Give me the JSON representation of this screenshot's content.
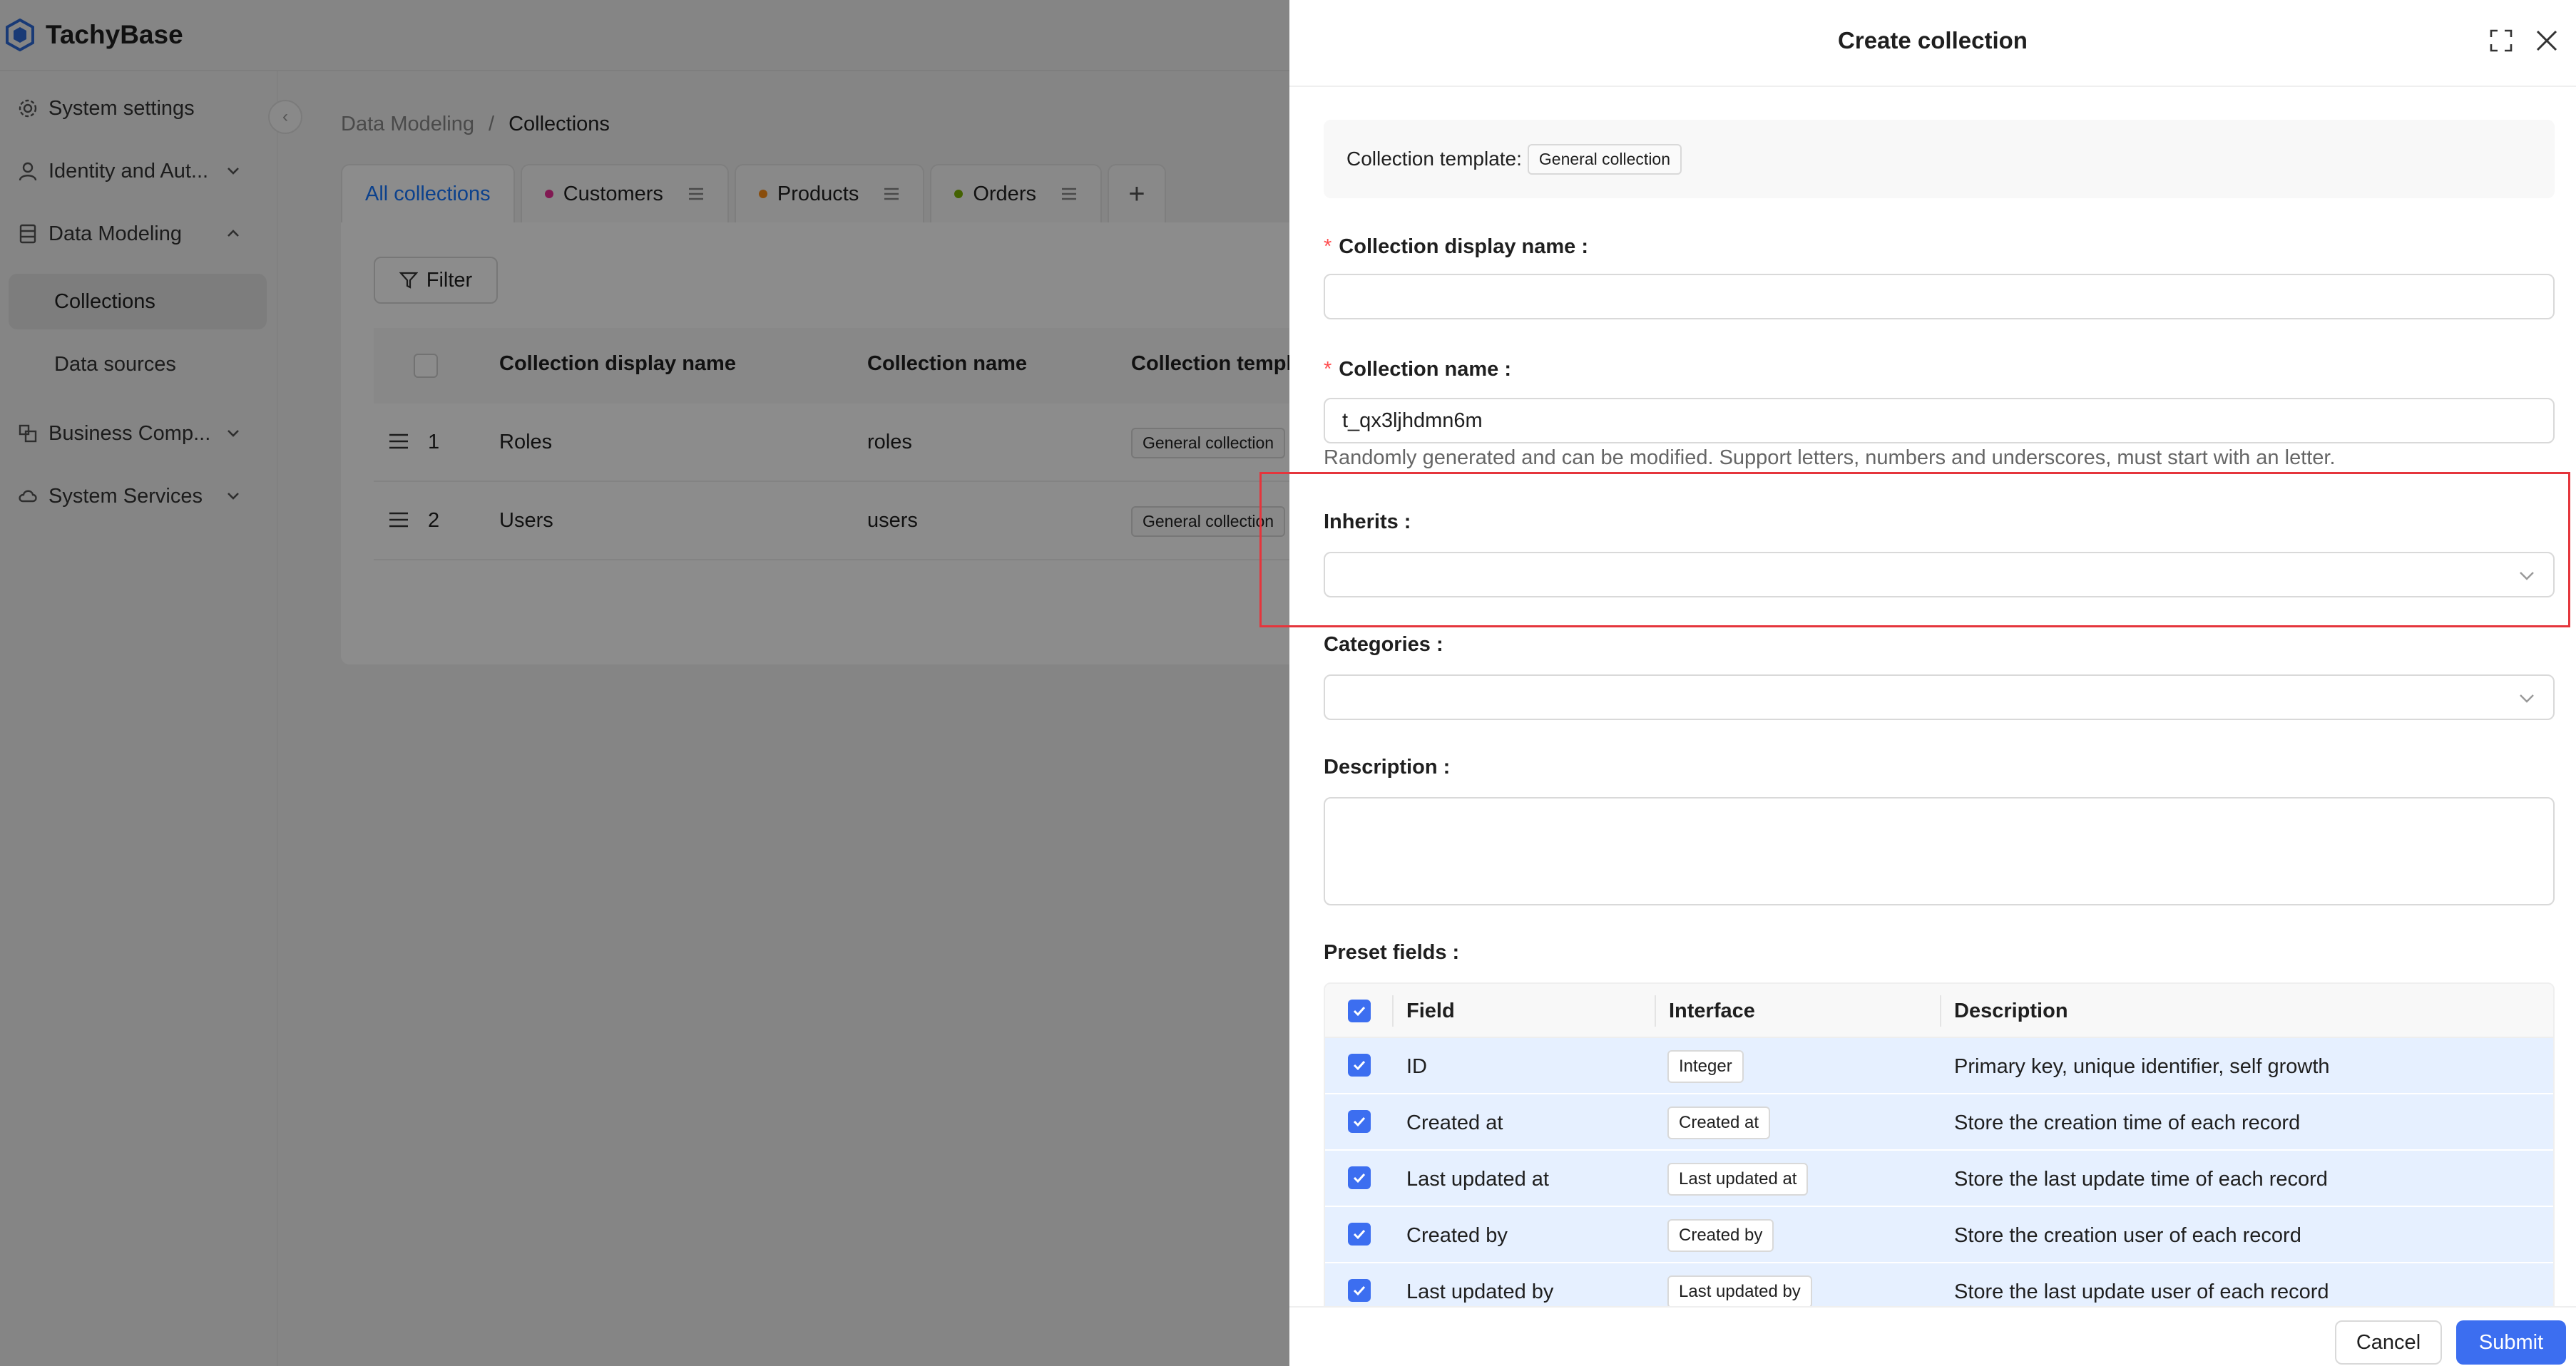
{
  "app": {
    "name": "TachyBase"
  },
  "sidebar": {
    "items": [
      {
        "label": "System settings",
        "icon": "gear-icon"
      },
      {
        "label": "Identity and Aut...",
        "icon": "user-icon"
      },
      {
        "label": "Data Modeling",
        "icon": "database-icon"
      },
      {
        "label": "Business Comp...",
        "icon": "blocks-icon"
      },
      {
        "label": "System Services",
        "icon": "cloud-icon"
      }
    ],
    "sub_items": [
      {
        "label": "Collections",
        "active": true
      },
      {
        "label": "Data sources",
        "active": false
      }
    ]
  },
  "breadcrumb": {
    "parent": "Data Modeling",
    "separator": "/",
    "current": "Collections"
  },
  "tabs": [
    {
      "label": "All collections",
      "active": true
    },
    {
      "label": "Customers",
      "dot_color": "#eb2f96"
    },
    {
      "label": "Products",
      "dot_color": "#fa8c16"
    },
    {
      "label": "Orders",
      "dot_color": "#7cb305"
    }
  ],
  "toolbar": {
    "filter_label": "Filter"
  },
  "table": {
    "columns": [
      "Collection display name",
      "Collection name",
      "Collection templ"
    ],
    "rows": [
      {
        "index": "1",
        "display_name": "Roles",
        "name": "roles",
        "template": "General collection"
      },
      {
        "index": "2",
        "display_name": "Users",
        "name": "users",
        "template": "General collection"
      }
    ]
  },
  "drawer": {
    "title": "Create collection",
    "template_label": "Collection template:",
    "template_value": "General collection",
    "display_name_label": "Collection display name",
    "display_name_value": "",
    "name_label": "Collection name",
    "name_value": "t_qx3ljhdmn6m",
    "name_help": "Randomly generated and can be modified. Support letters, numbers and underscores, must start with an letter.",
    "inherits_label": "Inherits",
    "categories_label": "Categories",
    "description_label": "Description",
    "preset_label": "Preset fields",
    "preset_columns": [
      "Field",
      "Interface",
      "Description"
    ],
    "preset_rows": [
      {
        "field": "ID",
        "interface": "Integer",
        "description": "Primary key, unique identifier, self growth"
      },
      {
        "field": "Created at",
        "interface": "Created at",
        "description": "Store the creation time of each record"
      },
      {
        "field": "Last updated at",
        "interface": "Last updated at",
        "description": "Store the last update time of each record"
      },
      {
        "field": "Created by",
        "interface": "Created by",
        "description": "Store the creation user of each record"
      },
      {
        "field": "Last updated by",
        "interface": "Last updated by",
        "description": "Store the last update user of each record"
      }
    ],
    "cancel_label": "Cancel",
    "submit_label": "Submit"
  },
  "colors": {
    "primary": "#3c6ef0",
    "required": "#ff4d4f",
    "highlight": "#e5353c",
    "row_selected": "#e6f0ff"
  }
}
